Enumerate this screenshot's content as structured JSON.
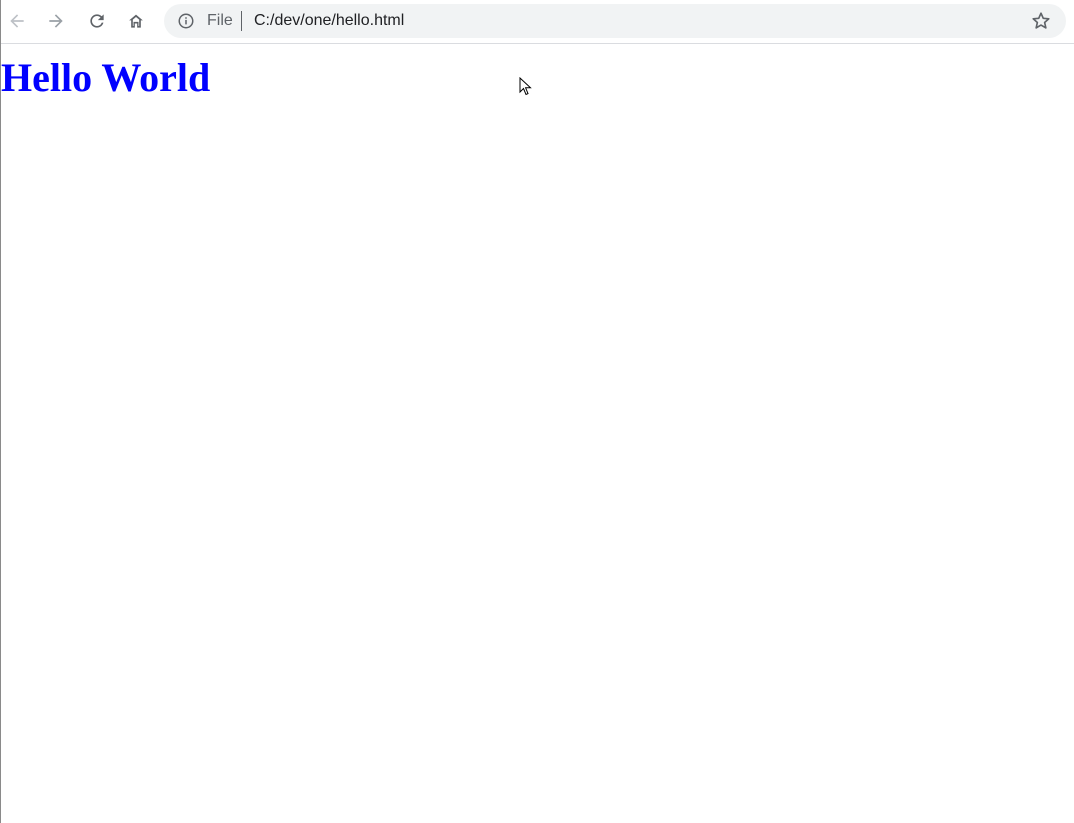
{
  "browser": {
    "toolbar": {
      "back_icon": "arrow-left-icon",
      "forward_icon": "arrow-right-icon",
      "reload_icon": "reload-icon",
      "home_icon": "home-icon"
    },
    "omnibox": {
      "info_icon": "info-icon",
      "scheme_label": "File",
      "url": "C:/dev/one/hello.html",
      "bookmark_icon": "star-icon"
    }
  },
  "page": {
    "heading": "Hello World",
    "heading_color": "#0000ff"
  },
  "colors": {
    "omnibox_bg": "#f1f3f4",
    "disabled_icon": "#9aa0a6",
    "active_icon": "#5f6368"
  }
}
